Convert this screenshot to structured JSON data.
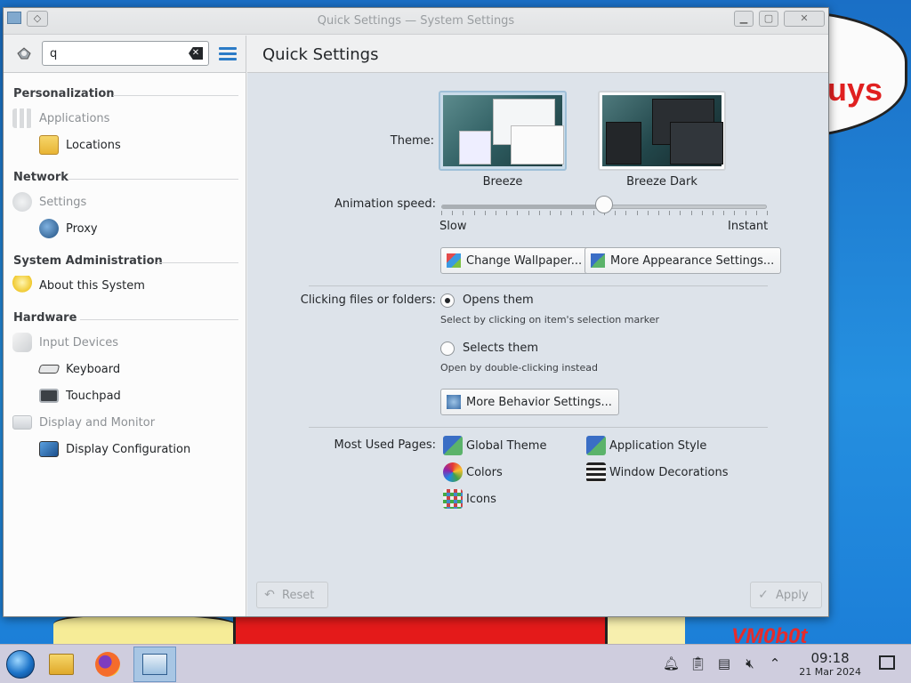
{
  "window": {
    "title": "Quick Settings — System Settings"
  },
  "sidebar": {
    "search_value": "q",
    "categories": [
      {
        "label": "Personalization"
      },
      {
        "label": "Network"
      },
      {
        "label": "System Administration"
      },
      {
        "label": "Hardware"
      }
    ],
    "items": [
      {
        "label": "Applications"
      },
      {
        "label": "Locations"
      },
      {
        "label": "Settings"
      },
      {
        "label": "Proxy"
      },
      {
        "label": "About this System"
      },
      {
        "label": "Input Devices"
      },
      {
        "label": "Keyboard"
      },
      {
        "label": "Touchpad"
      },
      {
        "label": "Display and Monitor"
      },
      {
        "label": "Display Configuration"
      }
    ]
  },
  "main": {
    "title": "Quick Settings",
    "theme_label": "Theme:",
    "themes": [
      {
        "label": "Breeze",
        "selected": true
      },
      {
        "label": "Breeze Dark",
        "selected": false
      }
    ],
    "animation_label": "Animation speed:",
    "animation": {
      "value": 0.5,
      "min_label": "Slow",
      "max_label": "Instant"
    },
    "change_wallpaper": "Change Wallpaper...",
    "more_appearance": "More Appearance Settings...",
    "clicking_label": "Clicking files or folders:",
    "click_options": [
      {
        "label": "Opens them",
        "hint": "Select by clicking on item's selection marker",
        "selected": true
      },
      {
        "label": "Selects them",
        "hint": "Open by double-clicking instead",
        "selected": false
      }
    ],
    "more_behavior": "More Behavior Settings...",
    "most_used_label": "Most Used Pages:",
    "most_used": [
      {
        "label": "Global Theme"
      },
      {
        "label": "Application Style"
      },
      {
        "label": "Colors"
      },
      {
        "label": "Window Decorations"
      },
      {
        "label": "Icons"
      }
    ],
    "reset": "Reset",
    "apply": "Apply"
  },
  "taskbar": {
    "time": "09:18",
    "date": "21 Mar 2024"
  },
  "wallpaper": {
    "text_1": "uys",
    "text_2": "VM0b0t"
  }
}
